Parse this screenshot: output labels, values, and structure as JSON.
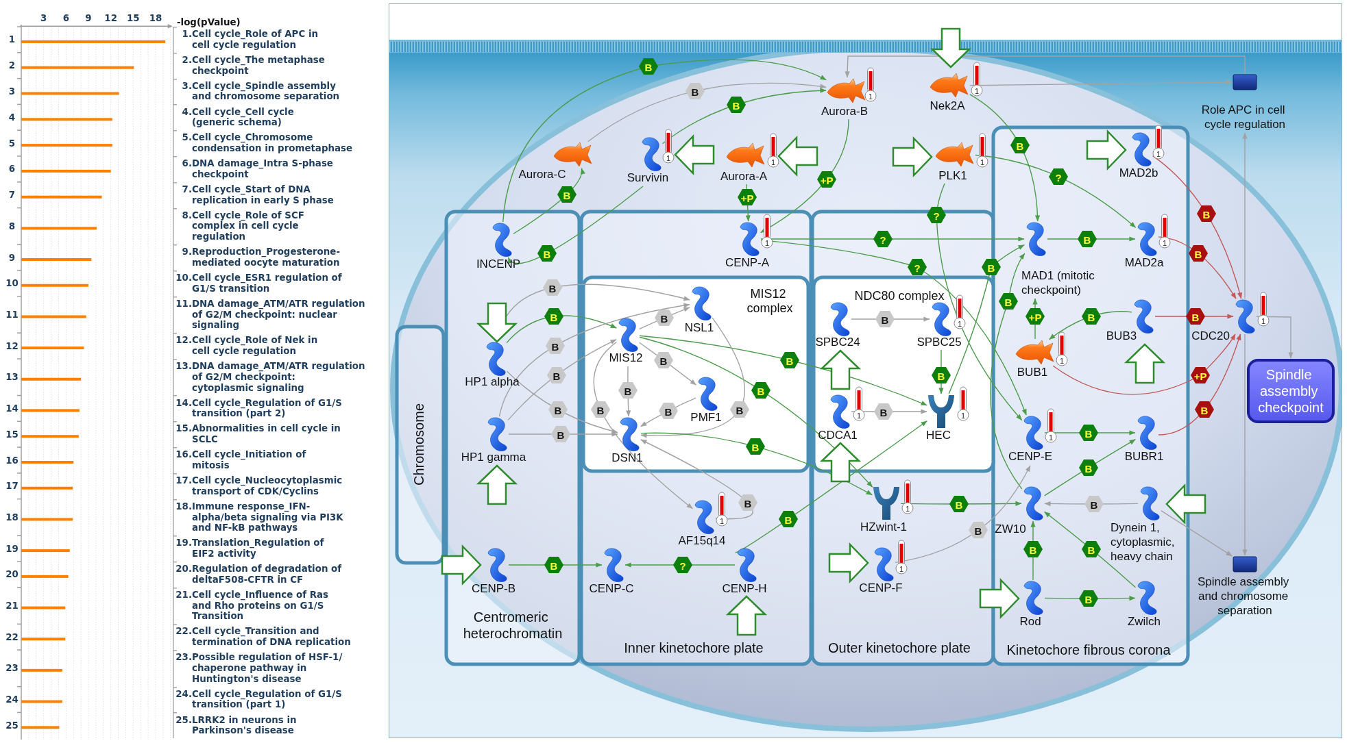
{
  "pathway_chart": {
    "chart_data": {
      "type": "bar",
      "orientation": "horizontal",
      "xlabel": "-log(pValue)",
      "categories": [
        "1",
        "2",
        "3",
        "4",
        "5",
        "6",
        "7",
        "8",
        "9",
        "10",
        "11",
        "12",
        "13",
        "14",
        "15",
        "16",
        "17",
        "18",
        "19",
        "20",
        "21",
        "22",
        "23",
        "24",
        "25"
      ],
      "values": [
        19.3,
        15.1,
        13.1,
        12.2,
        12.2,
        12.0,
        10.8,
        10.1,
        9.4,
        9.0,
        8.7,
        8.4,
        8.0,
        7.8,
        7.7,
        7.0,
        6.9,
        6.9,
        6.5,
        6.3,
        5.9,
        5.9,
        5.5,
        5.5,
        5.1
      ],
      "xticks": [
        3,
        6,
        9,
        12,
        15,
        18
      ],
      "xlim": [
        0,
        20
      ],
      "grid": true
    },
    "pathways": [
      {
        "number": "1.",
        "name": "Cell cycle_Role of APC in\ncell cycle regulation"
      },
      {
        "number": "2.",
        "name": "Cell cycle_The metaphase\ncheckpoint"
      },
      {
        "number": "3.",
        "name": "Cell cycle_Spindle assembly\nand chromosome separation"
      },
      {
        "number": "4.",
        "name": "Cell cycle_Cell cycle\n(generic schema)"
      },
      {
        "number": "5.",
        "name": "Cell cycle_Chromosome\ncondensation in prometaphase"
      },
      {
        "number": "6.",
        "name": "DNA damage_Intra S-phase\ncheckpoint"
      },
      {
        "number": "7.",
        "name": "Cell cycle_Start of DNA\nreplication in early S phase"
      },
      {
        "number": "8.",
        "name": "Cell cycle_Role of SCF\ncomplex in cell cycle\nregulation"
      },
      {
        "number": "9.",
        "name": "Reproduction_Progesterone-\nmediated oocyte maturation"
      },
      {
        "number": "10.",
        "name": "Cell cycle_ESR1 regulation of\nG1/S transition"
      },
      {
        "number": "11.",
        "name": "DNA damage_ATM/ATR regulation\nof G2/M checkpoint: nuclear\nsignaling"
      },
      {
        "number": "12.",
        "name": "Cell cycle_Role of Nek in\ncell cycle regulation"
      },
      {
        "number": "13.",
        "name": "DNA damage_ATM/ATR regulation\nof G2/M checkpoint:\ncytoplasmic signaling"
      },
      {
        "number": "14.",
        "name": "Cell cycle_Regulation of G1/S\ntransition (part 2)"
      },
      {
        "number": "15.",
        "name": "Abnormalities in cell cycle in\nSCLC"
      },
      {
        "number": "16.",
        "name": "Cell cycle_Initiation of\nmitosis"
      },
      {
        "number": "17.",
        "name": "Cell cycle_Nucleocytoplasmic\ntransport of CDK/Cyclins"
      },
      {
        "number": "18.",
        "name": "Immune response_IFN-\nalpha/beta signaling via PI3K\nand NF-kB pathways"
      },
      {
        "number": "19.",
        "name": "Translation_Regulation of\nEIF2 activity"
      },
      {
        "number": "20.",
        "name": "Regulation of degradation of\ndeltaF508-CFTR in CF"
      },
      {
        "number": "21.",
        "name": "Cell cycle_Influence of Ras\nand Rho proteins on G1/S\nTransition"
      },
      {
        "number": "22.",
        "name": "Cell cycle_Transition and\ntermination of DNA replication"
      },
      {
        "number": "23.",
        "name": "Possible regulation of HSF-1/\nchaperone pathway in\nHuntington's disease"
      },
      {
        "number": "24.",
        "name": "Cell cycle_Regulation of G1/S\ntransition (part 1)"
      },
      {
        "number": "25.",
        "name": "LRRK2 in neurons in\nParkinson's disease"
      }
    ]
  },
  "diagram": {
    "compartments": [
      {
        "label": "MIS12\ncomplex",
        "kind": "complex"
      },
      {
        "label": "NDC80 complex",
        "kind": "complex"
      },
      {
        "label": "Chromosome",
        "kind": "region"
      },
      {
        "label": "Centromeric\nheterochromatin",
        "kind": "region"
      },
      {
        "label": "Inner kinetochore plate",
        "kind": "region"
      },
      {
        "label": "Outer kinetochore plate",
        "kind": "region"
      },
      {
        "label": "Kinetochore fibrous corona",
        "kind": "region"
      }
    ],
    "nodes": [
      {
        "name": "Aurora-C",
        "kind": "kinase"
      },
      {
        "name": "INCENP",
        "kind": "protein"
      },
      {
        "name": "Survivin",
        "kind": "protein",
        "thermometer": "1",
        "block_arrow": {
          "kind": "left"
        }
      },
      {
        "name": "Aurora-A",
        "kind": "kinase",
        "thermometer": "1",
        "block_arrow": {
          "kind": "left"
        }
      },
      {
        "name": "Aurora-B",
        "kind": "kinase",
        "thermometer": "1"
      },
      {
        "name": "Nek2A",
        "kind": "kinase",
        "thermometer": "1",
        "block_arrow": {
          "kind": "down"
        }
      },
      {
        "name": "PLK1",
        "kind": "kinase",
        "thermometer": "1",
        "block_arrow": {
          "kind": "right"
        }
      },
      {
        "name": "MAD2b",
        "kind": "protein",
        "thermometer": "1",
        "block_arrow": {
          "kind": "right"
        }
      },
      {
        "name": "Role APC in cell\ncycle regulation",
        "kind": "process"
      },
      {
        "name": "CENP-A",
        "kind": "protein",
        "thermometer": "1"
      },
      {
        "name": "MAD1 (mitotic\ncheckpoint)",
        "kind": "protein"
      },
      {
        "name": "MAD2a",
        "kind": "protein",
        "thermometer": "1"
      },
      {
        "name": "NSL1",
        "kind": "protein"
      },
      {
        "name": "MIS12",
        "kind": "protein"
      },
      {
        "name": "SPBC24",
        "kind": "protein",
        "block_arrow": {
          "kind": "up"
        }
      },
      {
        "name": "SPBC25",
        "kind": "protein",
        "thermometer": "1"
      },
      {
        "name": "HP1 alpha",
        "kind": "protein",
        "block_arrow": {
          "kind": "down"
        }
      },
      {
        "name": "BUB3",
        "kind": "protein",
        "block_arrow": {
          "kind": "up"
        }
      },
      {
        "name": "CDC20",
        "kind": "protein",
        "thermometer": "1"
      },
      {
        "name": "BUB1",
        "kind": "kinase",
        "thermometer": "1"
      },
      {
        "name": "PMF1",
        "kind": "protein"
      },
      {
        "name": "Spindle\nassembly\ncheckpoint",
        "kind": "checkpoint"
      },
      {
        "name": "HP1 gamma",
        "kind": "protein",
        "block_arrow": {
          "kind": "up"
        }
      },
      {
        "name": "DSN1",
        "kind": "protein"
      },
      {
        "name": "CDCA1",
        "kind": "protein",
        "thermometer": "1",
        "block_arrow": {
          "kind": "up"
        }
      },
      {
        "name": "HEC",
        "kind": "receptor",
        "thermometer": "1"
      },
      {
        "name": "CENP-E",
        "kind": "protein",
        "thermometer": "1"
      },
      {
        "name": "BUBR1",
        "kind": "protein"
      },
      {
        "name": "AF15q14",
        "kind": "protein",
        "thermometer": "1"
      },
      {
        "name": "HZwint-1",
        "kind": "receptor",
        "thermometer": "1"
      },
      {
        "name": "ZW10",
        "kind": "protein"
      },
      {
        "name": "Dynein 1,\ncytoplasmic,\nheavy chain",
        "kind": "protein",
        "block_arrow": {
          "kind": "left"
        }
      },
      {
        "name": "CENP-B",
        "kind": "protein",
        "block_arrow": {
          "kind": "right"
        }
      },
      {
        "name": "CENP-C",
        "kind": "protein"
      },
      {
        "name": "CENP-H",
        "kind": "protein",
        "block_arrow": {
          "kind": "up"
        }
      },
      {
        "name": "CENP-F",
        "kind": "protein",
        "thermometer": "1",
        "block_arrow": {
          "kind": "right"
        }
      },
      {
        "name": "Rod",
        "kind": "protein",
        "block_arrow": {
          "kind": "right"
        }
      },
      {
        "name": "Zwilch",
        "kind": "protein"
      },
      {
        "name": "Spindle assembly\nand chromosome\nseparation",
        "kind": "process"
      }
    ],
    "edges": [
      {
        "kind": "activation",
        "mechanism": "B"
      },
      {
        "kind": "unspecified",
        "mechanism": "B"
      },
      {
        "kind": "activation",
        "mechanism": "B"
      },
      {
        "kind": "activation",
        "mechanism": "B"
      },
      {
        "kind": "activation",
        "mechanism": "+P"
      },
      {
        "kind": "activation",
        "mechanism": "?"
      },
      {
        "kind": "activation",
        "mechanism": "B"
      },
      {
        "kind": "activation",
        "mechanism": "+P"
      },
      {
        "kind": "activation",
        "mechanism": "?"
      },
      {
        "kind": "inhibition",
        "mechanism": "B"
      },
      {
        "kind": "activation",
        "mechanism": "?"
      },
      {
        "kind": "activation",
        "mechanism": "B"
      },
      {
        "kind": "activation",
        "mechanism": "B"
      },
      {
        "kind": "inhibition",
        "mechanism": "B"
      },
      {
        "kind": "activation",
        "mechanism": "?"
      },
      {
        "kind": "activation",
        "mechanism": "B"
      },
      {
        "kind": "unspecified",
        "mechanism": "B"
      },
      {
        "kind": "activation",
        "mechanism": "B"
      },
      {
        "kind": "activation",
        "mechanism": "B"
      },
      {
        "kind": "unspecified",
        "mechanism": "B"
      },
      {
        "kind": "unspecified",
        "mechanism": "B"
      },
      {
        "kind": "activation",
        "mechanism": "+P"
      },
      {
        "kind": "activation",
        "mechanism": "B"
      },
      {
        "kind": "inhibition",
        "mechanism": "B"
      },
      {
        "kind": "unspecified",
        "mechanism": "B"
      },
      {
        "kind": "unspecified",
        "mechanism": "B"
      },
      {
        "kind": "activation",
        "mechanism": "B"
      },
      {
        "kind": "unspecified",
        "mechanism": "B"
      },
      {
        "kind": "activation",
        "mechanism": "B"
      },
      {
        "kind": "inhibition",
        "mechanism": "+P"
      },
      {
        "kind": "unspecified",
        "mechanism": "B"
      },
      {
        "kind": "activation",
        "mechanism": "B"
      },
      {
        "kind": "unspecified",
        "mechanism": "B"
      },
      {
        "kind": "unspecified",
        "mechanism": "B"
      },
      {
        "kind": "unspecified",
        "mechanism": "B"
      },
      {
        "kind": "unspecified",
        "mechanism": "B"
      },
      {
        "kind": "unspecified",
        "mechanism": "B"
      },
      {
        "kind": "inhibition",
        "mechanism": "B"
      },
      {
        "kind": "unspecified",
        "mechanism": "B"
      },
      {
        "kind": "activation",
        "mechanism": "B"
      },
      {
        "kind": "activation",
        "mechanism": "B"
      },
      {
        "kind": "activation",
        "mechanism": "B"
      },
      {
        "kind": "unspecified",
        "mechanism": "B"
      },
      {
        "kind": "activation",
        "mechanism": "B"
      },
      {
        "kind": "unspecified",
        "mechanism": "B"
      },
      {
        "kind": "activation",
        "mechanism": "B"
      },
      {
        "kind": "unspecified",
        "mechanism": "B"
      },
      {
        "kind": "activation",
        "mechanism": "B"
      },
      {
        "kind": "activation",
        "mechanism": "B"
      },
      {
        "kind": "activation",
        "mechanism": "B"
      },
      {
        "kind": "activation",
        "mechanism": "?"
      },
      {
        "kind": "activation",
        "mechanism": "B"
      },
      {
        "kind": "unspecified"
      },
      {
        "kind": "unspecified"
      },
      {
        "kind": "unspecified"
      },
      {
        "kind": "unspecified"
      },
      {
        "kind": "unspecified"
      },
      {
        "kind": "unspecified"
      }
    ]
  }
}
